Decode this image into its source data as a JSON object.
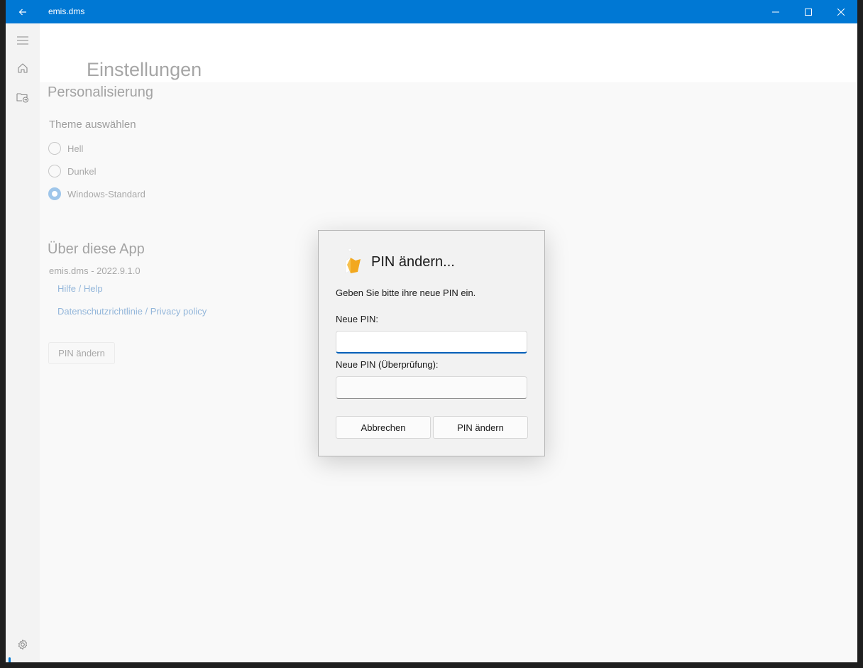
{
  "window": {
    "title": "emis.dms",
    "accent_color": "#0078d4"
  },
  "titlebar": {
    "back_icon": "arrow-left-icon",
    "minimize_icon": "minimize-icon",
    "maximize_icon": "maximize-icon",
    "close_icon": "close-icon"
  },
  "nav": {
    "items": [
      {
        "icon": "hamburger-menu-icon"
      },
      {
        "icon": "home-icon"
      },
      {
        "icon": "folder-sync-icon"
      }
    ],
    "settings_icon": "gear-icon"
  },
  "page": {
    "title": "Einstellungen",
    "personalization": {
      "heading": "Personalisierung",
      "theme_label": "Theme auswählen",
      "options": [
        {
          "label": "Hell",
          "checked": false
        },
        {
          "label": "Dunkel",
          "checked": false
        },
        {
          "label": "Windows-Standard",
          "checked": true
        }
      ]
    },
    "about": {
      "heading": "Über diese App",
      "version": "emis.dms - 2022.9.1.0",
      "links": [
        "Hilfe / Help",
        "Datenschutzrichtlinie / Privacy policy"
      ]
    },
    "change_pin_button": "PIN ändern"
  },
  "dialog": {
    "title": "PIN ändern...",
    "message": "Geben Sie bitte ihre neue PIN ein.",
    "new_pin_label": "Neue PIN:",
    "new_pin_value": "",
    "confirm_pin_label": "Neue PIN (Überprüfung):",
    "confirm_pin_value": "",
    "cancel_label": "Abbrechen",
    "confirm_label": "PIN ändern",
    "icon": "pin-key-icon"
  }
}
